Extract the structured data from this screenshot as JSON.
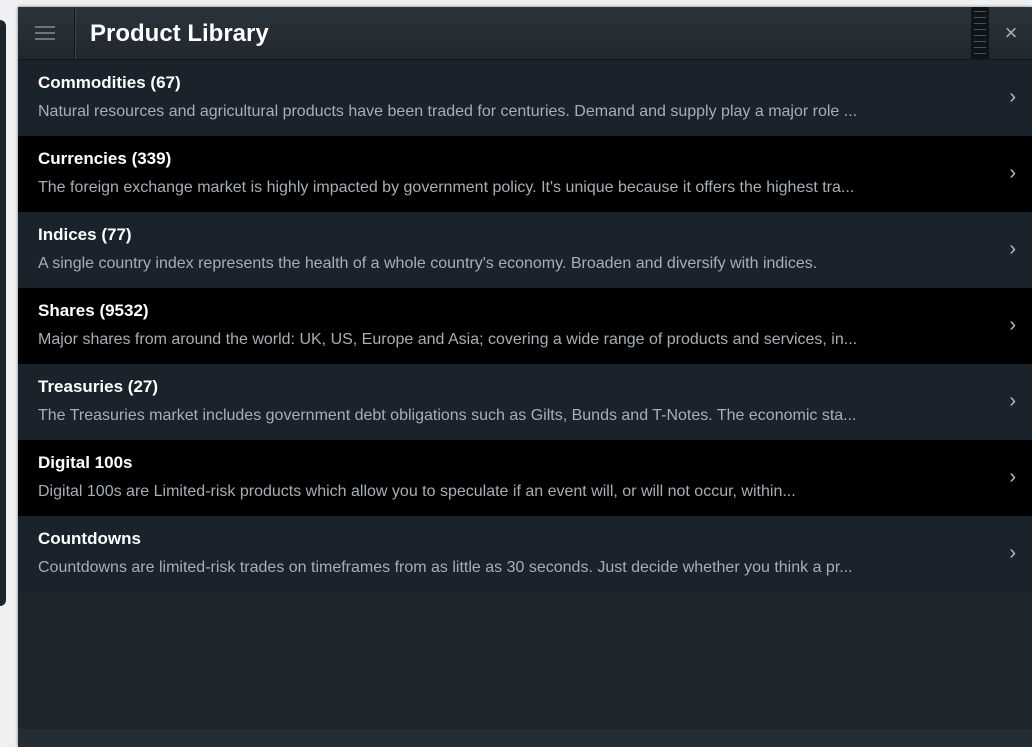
{
  "window": {
    "title": "Product Library",
    "close_label": "×"
  },
  "products": [
    {
      "name": "Commodities",
      "count": "(67)",
      "description": "Natural resources and agricultural products have been traded for centuries. Demand and supply play a major role ..."
    },
    {
      "name": "Currencies",
      "count": "(339)",
      "description": "The foreign exchange market is highly impacted by government policy. It's unique because it offers the highest tra..."
    },
    {
      "name": "Indices",
      "count": "(77)",
      "description": "A single country index represents the health of a whole country's economy. Broaden and diversify with indices."
    },
    {
      "name": "Shares",
      "count": "(9532)",
      "description": "Major shares from around the world: UK, US, Europe and Asia; covering a wide range of products and services, in..."
    },
    {
      "name": "Treasuries",
      "count": "(27)",
      "description": "The Treasuries market includes government debt obligations such as Gilts, Bunds and T-Notes. The economic sta..."
    },
    {
      "name": "Digital 100s",
      "count": "",
      "description": "Digital 100s are Limited-risk products which allow you to speculate if an event will, or will not occur, within..."
    },
    {
      "name": "Countdowns",
      "count": "",
      "description": "Countdowns are limited-risk trades on timeframes from as little as 30 seconds.  Just decide whether you think a pr..."
    }
  ],
  "icons": {
    "menu": "hamburger-icon",
    "close": "close-icon",
    "row_arrow": "chevron-right-icon"
  },
  "colors": {
    "title_text": "#ffffff",
    "description_text": "#a6aeb6",
    "row_odd": "#1a232b",
    "row_even": "#000000"
  }
}
